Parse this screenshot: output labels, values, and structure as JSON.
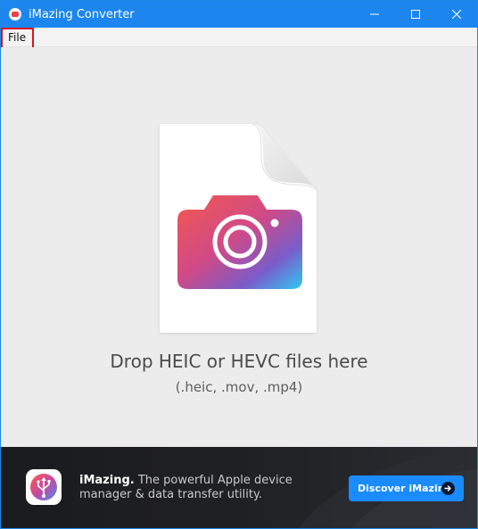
{
  "window": {
    "title": "iMazing Converter",
    "accent_color": "#1c86ee"
  },
  "menu": {
    "items": [
      {
        "label": "File"
      }
    ]
  },
  "dropzone": {
    "title": "Drop HEIC or HEVC files here",
    "subtitle": "(.heic, .mov, .mp4)",
    "icon": "camera-document-icon"
  },
  "footer": {
    "brand": "iMazing.",
    "description": "The powerful Apple device manager & data transfer utility.",
    "button_label": "Discover iMazing",
    "button_color": "#1a8cff",
    "icon": "imazing-usb-icon"
  }
}
